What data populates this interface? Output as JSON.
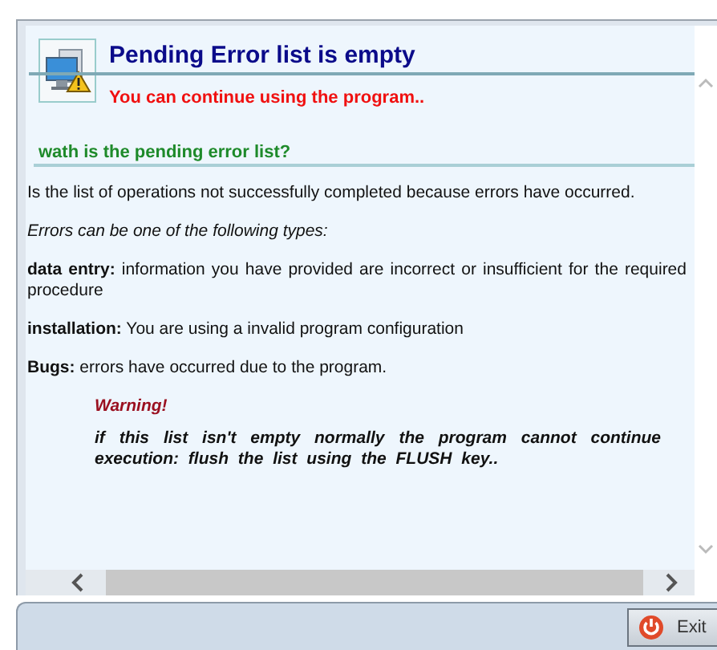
{
  "header": {
    "title": "Pending Error list is empty",
    "subtitle": "You can continue using the program.."
  },
  "section": {
    "heading": "wath is the pending error list?"
  },
  "paragraphs": [
    {
      "kind": "plain",
      "text": "Is the list of operations not successfully completed because errors have occurred."
    },
    {
      "kind": "italic",
      "text": "Errors can be one of the following types:"
    },
    {
      "kind": "plain",
      "text": "**data entry:** information you have provided are incorrect or insufficient for the required procedure"
    },
    {
      "kind": "plain",
      "text": "**installation:** You are using a invalid program configuration"
    },
    {
      "kind": "plain",
      "text": "**Bugs:** errors have occurred due to the program."
    }
  ],
  "warning": {
    "title": "Warning!",
    "text": "if this list isn't empty normally the program cannot continue execution: flush the list using the FLUSH key.."
  },
  "footer": {
    "exit_button": "Exit"
  }
}
